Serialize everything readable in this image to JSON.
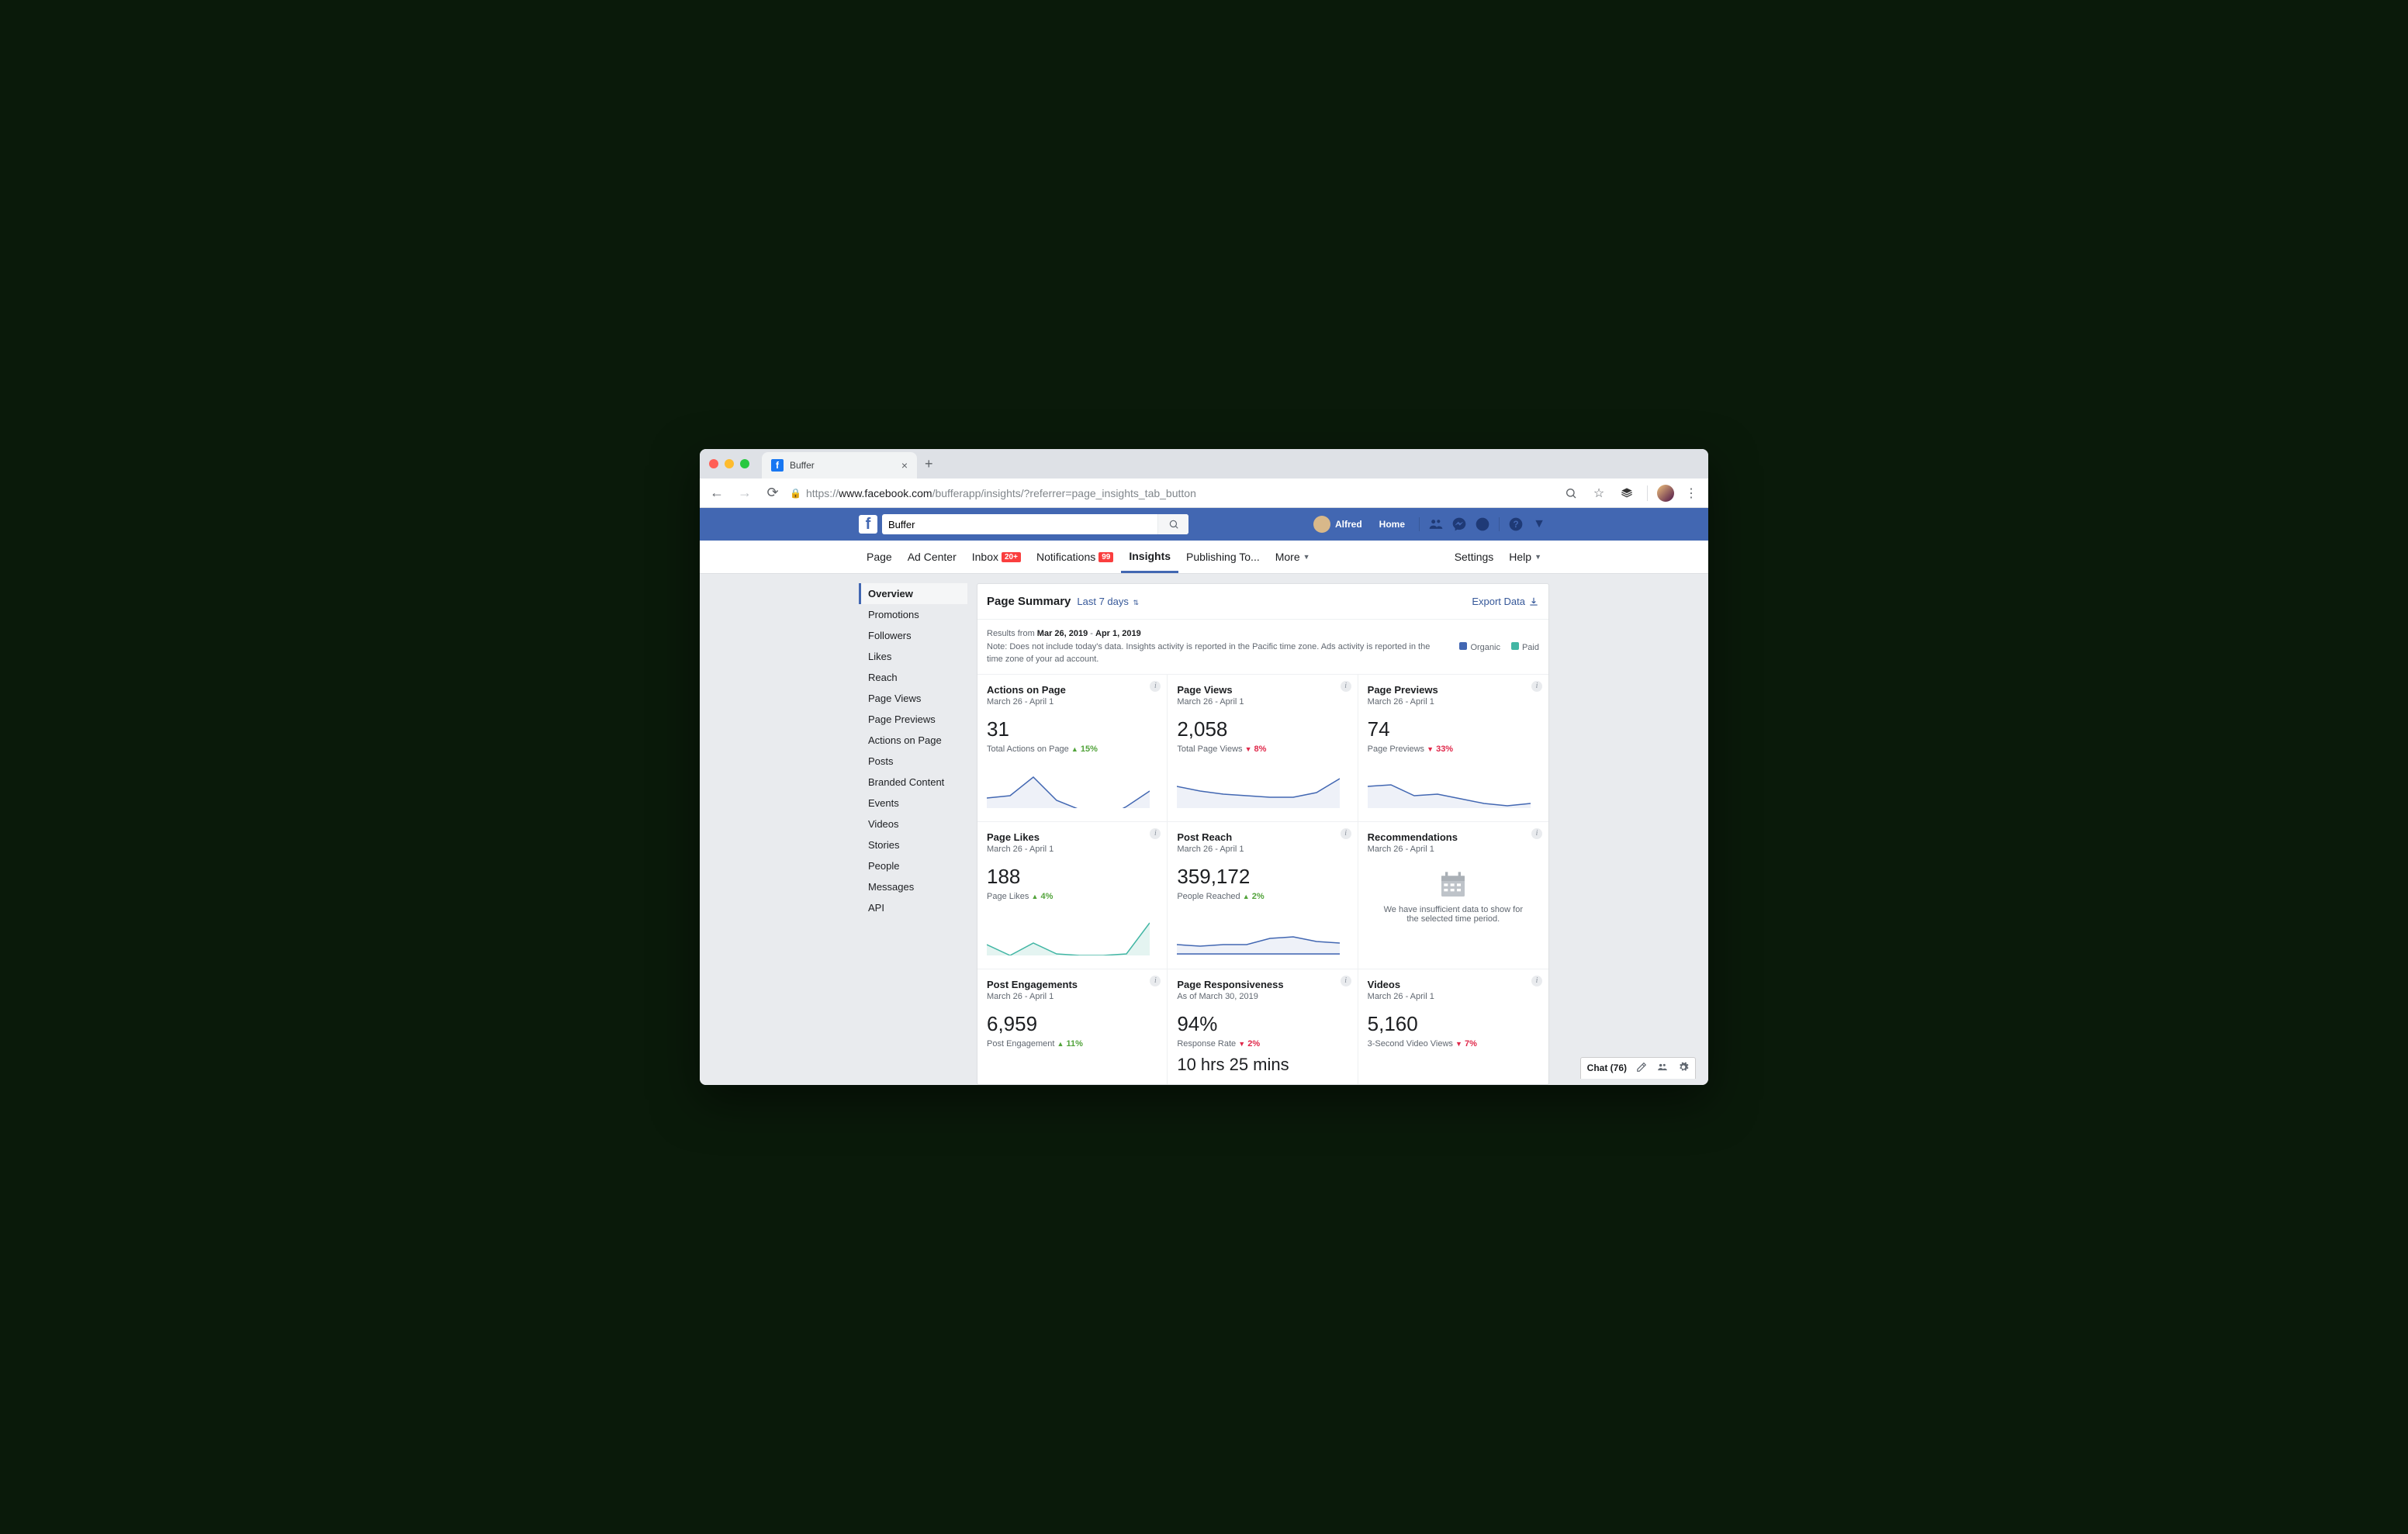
{
  "browser": {
    "tab_title": "Buffer",
    "url_prefix": "https://",
    "url_host": "www.facebook.com",
    "url_path": "/bufferapp/insights/?referrer=page_insights_tab_button"
  },
  "fb_header": {
    "search_value": "Buffer",
    "user_name": "Alfred",
    "home_label": "Home"
  },
  "tabs": {
    "page": "Page",
    "ad_center": "Ad Center",
    "inbox": "Inbox",
    "inbox_badge": "20+",
    "notifications": "Notifications",
    "notifications_badge": "99",
    "insights": "Insights",
    "publishing": "Publishing To...",
    "more": "More",
    "settings": "Settings",
    "help": "Help"
  },
  "sidebar": {
    "items": [
      "Overview",
      "Promotions",
      "Followers",
      "Likes",
      "Reach",
      "Page Views",
      "Page Previews",
      "Actions on Page",
      "Posts",
      "Branded Content",
      "Events",
      "Videos",
      "Stories",
      "People",
      "Messages",
      "API"
    ]
  },
  "summary": {
    "title": "Page Summary",
    "range_label": "Last 7 days",
    "export_label": "Export Data",
    "results_prefix": "Results from ",
    "date_from": "Mar 26, 2019",
    "date_sep": " - ",
    "date_to": "Apr 1, 2019",
    "note": "Note: Does not include today's data. Insights activity is reported in the Pacific time zone. Ads activity is reported in the time zone of your ad account.",
    "legend_organic": "Organic",
    "legend_paid": "Paid"
  },
  "cards": [
    {
      "title": "Actions on Page",
      "sub": "March 26 - April 1",
      "value": "31",
      "desc": "Total Actions on Page",
      "delta": "15%",
      "dir": "up",
      "series": "blue",
      "points": [
        45,
        42,
        18,
        48,
        60,
        72,
        56,
        36
      ]
    },
    {
      "title": "Page Views",
      "sub": "March 26 - April 1",
      "value": "2,058",
      "desc": "Total Page Views",
      "delta": "8%",
      "dir": "down",
      "series": "blue",
      "points": [
        30,
        36,
        40,
        42,
        44,
        44,
        38,
        20
      ]
    },
    {
      "title": "Page Previews",
      "sub": "March 26 - April 1",
      "value": "74",
      "desc": "Page Previews",
      "delta": "33%",
      "dir": "down",
      "series": "blue",
      "points": [
        30,
        28,
        42,
        40,
        46,
        52,
        55,
        52
      ]
    },
    {
      "title": "Page Likes",
      "sub": "March 26 - April 1",
      "value": "188",
      "desc": "Page Likes",
      "delta": "4%",
      "dir": "up",
      "series": "teal",
      "points": [
        44,
        58,
        42,
        56,
        58,
        58,
        56,
        16
      ]
    },
    {
      "title": "Post Reach",
      "sub": "March 26 - April 1",
      "value": "359,172",
      "desc": "People Reached",
      "delta": "2%",
      "dir": "up",
      "series": "dual",
      "points": [
        44,
        46,
        44,
        44,
        36,
        34,
        40,
        42
      ],
      "points2": [
        56,
        56,
        56,
        56,
        56,
        56,
        56,
        56
      ]
    },
    {
      "title": "Recommendations",
      "sub": "March 26 - April 1",
      "nodata": true,
      "nodata_msg": "We have insufficient data to show for the selected time period."
    },
    {
      "title": "Post Engagements",
      "sub": "March 26 - April 1",
      "value": "6,959",
      "desc": "Post Engagement",
      "delta": "11%",
      "dir": "up"
    },
    {
      "title": "Page Responsiveness",
      "sub": "As of March 30, 2019",
      "value": "94%",
      "desc": "Response Rate",
      "delta": "2%",
      "dir": "down",
      "extra": "10 hrs 25 mins"
    },
    {
      "title": "Videos",
      "sub": "March 26 - April 1",
      "value": "5,160",
      "desc": "3-Second Video Views",
      "delta": "7%",
      "dir": "down"
    }
  ],
  "chat": {
    "label": "Chat (76)"
  }
}
